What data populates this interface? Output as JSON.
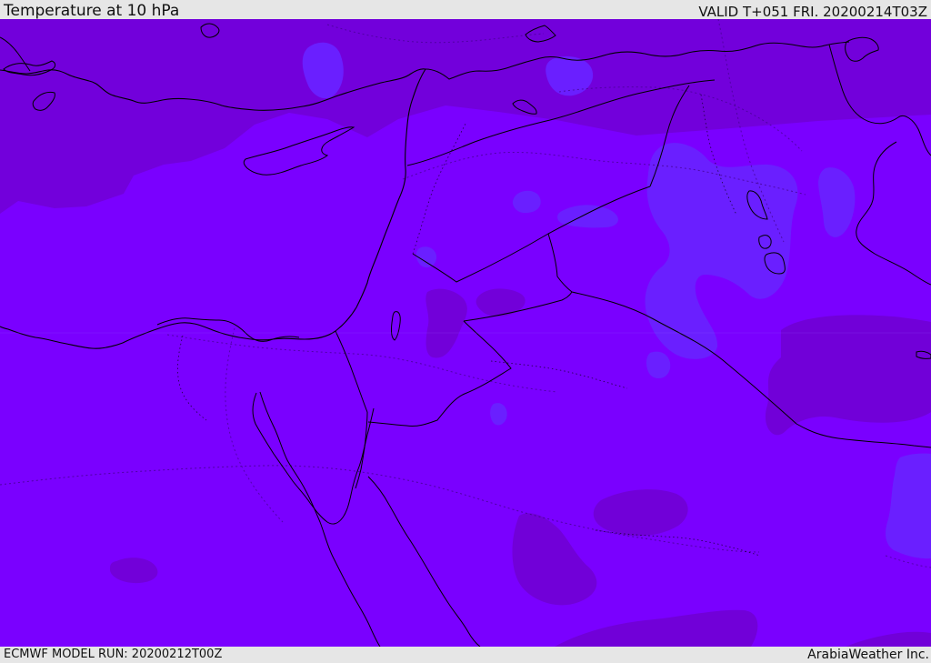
{
  "header": {
    "title": "Temperature at 10 hPa",
    "valid_time": "VALID T+051 FRI. 20200214T03Z"
  },
  "footer": {
    "model_run": "ECMWF MODEL RUN: 20200212T00Z",
    "credit": "ArabiaWeather Inc."
  },
  "map": {
    "field": "temperature",
    "pressure_level_hpa": 10,
    "colors": {
      "base_field": "#7a00ff",
      "warmer_region": "#7200d9",
      "cooler_region": "#6a1fff",
      "coastline": "#000000",
      "border": "#000000",
      "background": "#e6e6e6"
    }
  }
}
